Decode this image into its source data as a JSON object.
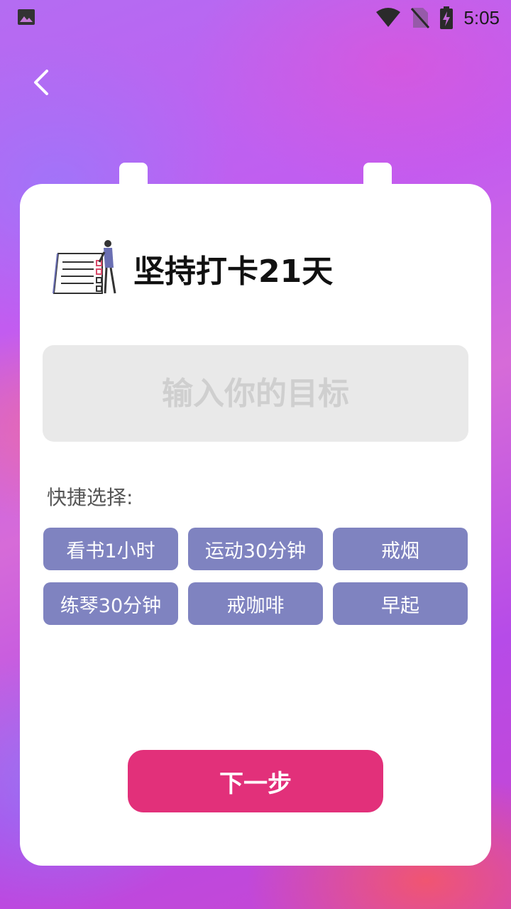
{
  "status_bar": {
    "time": "5:05",
    "icons": [
      "image-icon",
      "wifi-icon",
      "no-sim-icon",
      "battery-charging-icon"
    ]
  },
  "navigation": {
    "back_icon": "chevron-left-icon"
  },
  "card": {
    "title": "坚持打卡21天",
    "illustration": "checklist-person-illustration",
    "goal_input": {
      "placeholder": "输入你的目标",
      "value": ""
    },
    "quick_label": "快捷选择:",
    "quick_options": [
      {
        "label": "看书1小时"
      },
      {
        "label": "运动30分钟"
      },
      {
        "label": "戒烟"
      },
      {
        "label": "练琴30分钟"
      },
      {
        "label": "戒咖啡"
      },
      {
        "label": "早起"
      }
    ],
    "next_label": "下一步"
  },
  "colors": {
    "chip": "#7f83c0",
    "primary_button": "#e2307a",
    "input_bg": "#e9e9e9"
  }
}
